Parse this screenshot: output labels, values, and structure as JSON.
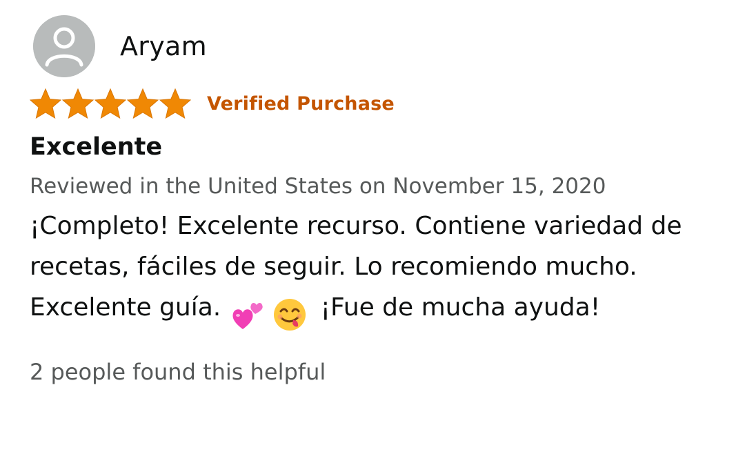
{
  "reviewer": {
    "name": "Aryam",
    "avatar_icon": "default-profile-icon"
  },
  "rating": {
    "stars": 5,
    "out_of": 5,
    "star_color": "#f08804",
    "badge": "Verified Purchase",
    "badge_color": "#c45500"
  },
  "review": {
    "title": "Excelente",
    "date_line": "Reviewed in the United States on November 15, 2020",
    "body_part1": "¡Completo! Excelente recurso. Contiene variedad de recetas, fáciles de seguir. Lo recomiendo mucho. Excelente guía.",
    "emojis": [
      "two-hearts-icon",
      "yum-face-icon"
    ],
    "body_part2": "¡Fue de mucha ayuda!"
  },
  "helpful": {
    "text": "2 people found this helpful"
  }
}
